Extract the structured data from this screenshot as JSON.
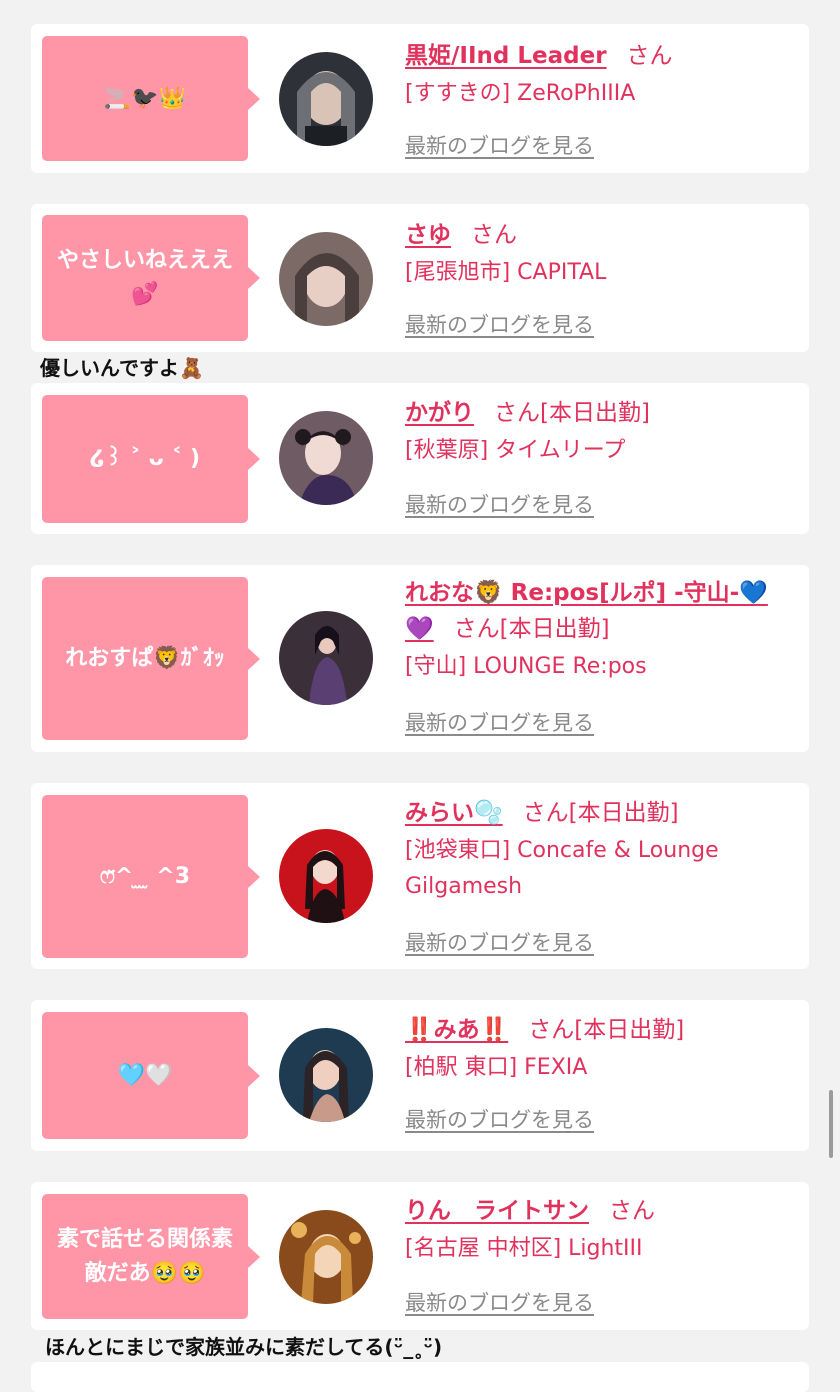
{
  "cards": [
    {
      "bubble": "🚬🐦‍⬛👑",
      "name": "黒姫/IInd Leader",
      "san": "さん",
      "status": "",
      "shop": "[すすきの] ZeRoPhIIIA",
      "blog": "最新のブログを見る",
      "avatar_colors": [
        "#2e3238",
        "#6d6f74",
        "#d9c2b6"
      ]
    },
    {
      "bubble": "やさしいねえええ💕",
      "name": "さゆ",
      "san": "さん",
      "status": "",
      "shop": "[尾張旭市] CAPITAL",
      "blog": "最新のブログを見る",
      "avatar_colors": [
        "#4a3f3d",
        "#7b6a66",
        "#e7cfc6"
      ]
    },
    {
      "bubble": "໒꒱ ˃ ᴗ ˂ )",
      "name": "かがり",
      "san": "さん",
      "status": "[本日出勤]",
      "shop": "[秋葉原] タイムリープ",
      "blog": "最新のブログを見る",
      "avatar_colors": [
        "#6f5b63",
        "#3a2a55",
        "#f1d9d4"
      ]
    },
    {
      "bubble": "れおすぱ🦁ｶﾞｵｯ",
      "name": "れおな🦁 Re:pos[ルポ] -守山-💙💜",
      "san": "さん",
      "status": "[本日出勤]",
      "shop": "[守山] LOUNGE Re:pos",
      "blog": "最新のブログを見る",
      "avatar_colors": [
        "#3b2f3a",
        "#5a3f72",
        "#e9c9bd"
      ]
    },
    {
      "bubble": "ෆ̈^ ̫ ̫ ^3",
      "name": "みらい🫧",
      "san": "さん",
      "status": "[本日出勤]",
      "shop": "[池袋東口] Concafe & Lounge Gilgamesh",
      "blog": "最新のブログを見る",
      "avatar_colors": [
        "#c8131c",
        "#1e1013",
        "#f2d8cd"
      ]
    },
    {
      "bubble": "🩵🤍",
      "name": "‼️みあ‼️",
      "san": "さん",
      "status": "[本日出勤]",
      "shop": "[柏駅 東口] FEXIA",
      "blog": "最新のブログを見る",
      "avatar_colors": [
        "#1e3b52",
        "#2c2326",
        "#f0cfc1"
      ]
    },
    {
      "bubble": "素で話せる関係素敵だあ🥹🥹",
      "name": "りん　ライトサン",
      "san": "さん",
      "status": "",
      "shop": "[名古屋 中村区] LightIII",
      "blog": "最新のブログを見る",
      "avatar_colors": [
        "#8a4b1c",
        "#c98a3a",
        "#f3d6b8"
      ]
    }
  ],
  "comments": {
    "after_card_2": "優しいんですよ🧸",
    "after_card_7": "ほんとにまじで家族並みに素だしてる(ᵕ̈_˳ᵕ̈)"
  },
  "colors": {
    "accent": "#e0325d",
    "bubble": "#ff96a8",
    "background": "#f2f2f2"
  }
}
